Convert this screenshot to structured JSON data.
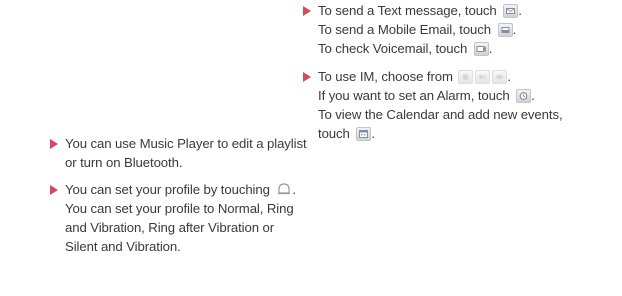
{
  "left_column": {
    "bullet_music": {
      "line1": "You can use Music Player to edit a playlist",
      "line2": "or turn on Bluetooth."
    },
    "bullet_profile": {
      "line1": "You can set your profile by touching",
      "line2": "You can set your profile to Normal, Ring",
      "line3": "and Vibration, Ring after Vibration or",
      "line4": "Silent and Vibration.",
      "icon": "bell-icon"
    }
  },
  "right_column": {
    "bullet_messaging": {
      "line1": "To send a Text message, touch",
      "line2": "To send a Mobile Email, touch",
      "line3": "To check Voicemail, touch",
      "icons": [
        "text-message-icon",
        "mobile-email-icon",
        "voicemail-icon"
      ]
    },
    "bullet_im": {
      "line1": "To use IM, choose from",
      "line2": "If you want to set an Alarm, touch",
      "line3": "To view the Calendar and add new events,",
      "line4": "touch",
      "icons": [
        "im-icon-1",
        "im-icon-2",
        "im-icon-3",
        "alarm-icon",
        "calendar-icon"
      ]
    }
  },
  "colors": {
    "bullet_arrow": "#d24b62",
    "text": "#3a3a3a"
  }
}
